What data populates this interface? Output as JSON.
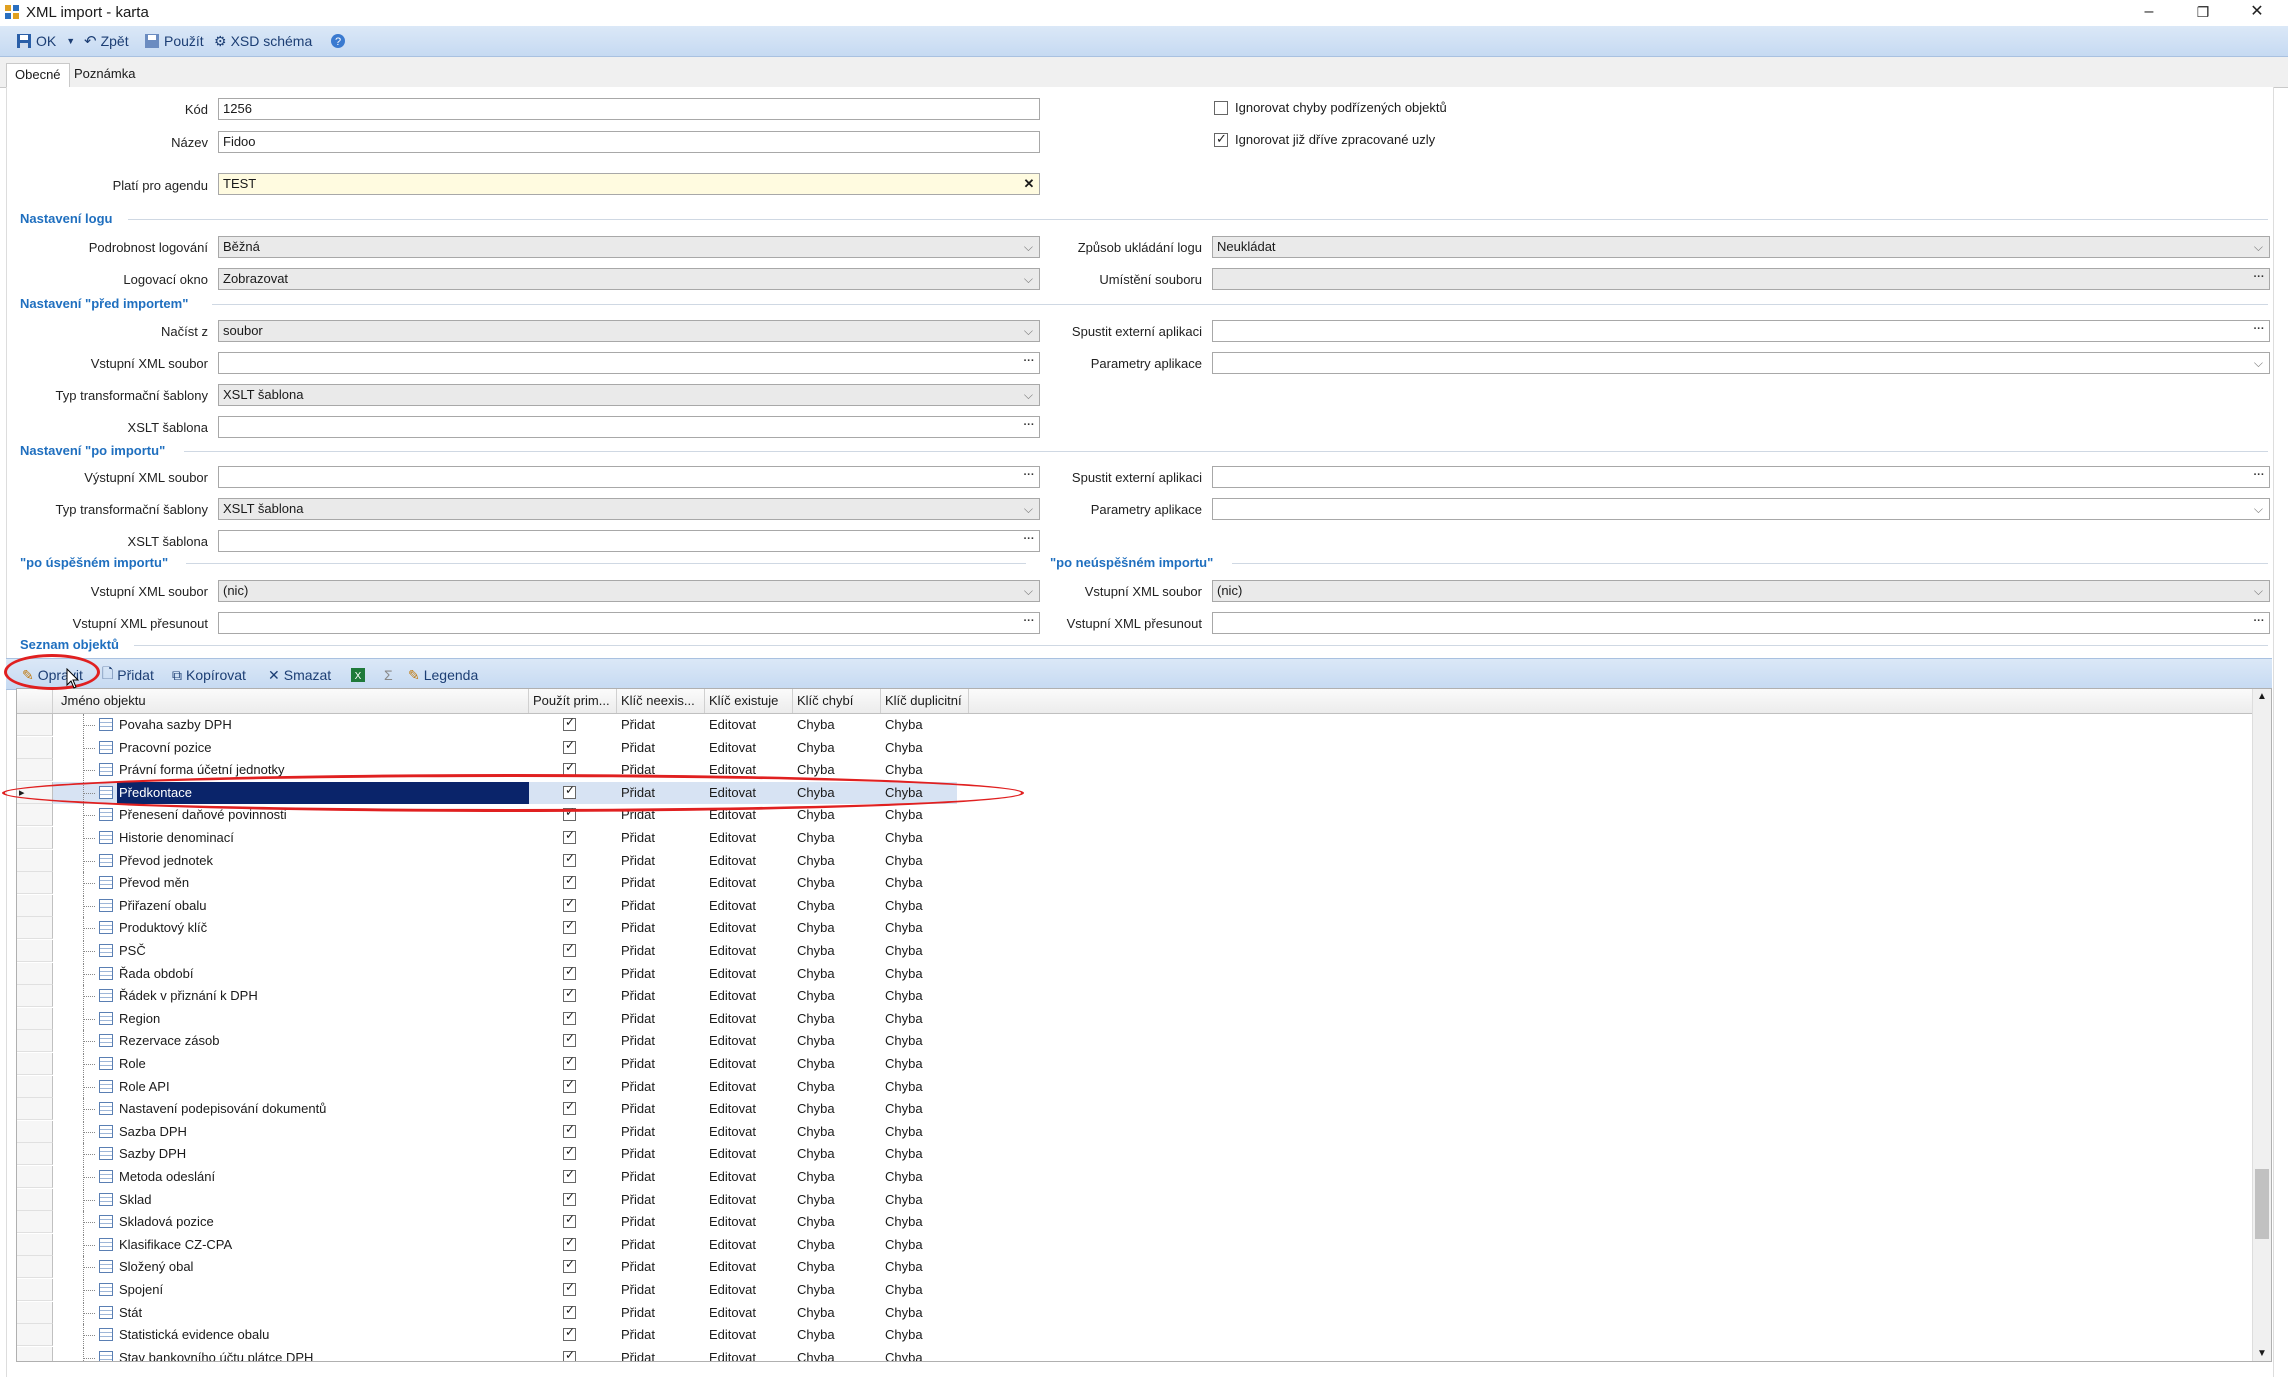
{
  "window": {
    "title": "XML import - karta",
    "min": "–",
    "max": "❐",
    "close": "✕"
  },
  "toolbar": {
    "ok": "OK",
    "back": "Zpět",
    "apply": "Použít",
    "xsd": "XSD schéma"
  },
  "tabs": [
    "Obecné",
    "Poznámka"
  ],
  "form": {
    "kod_label": "Kód",
    "kod_value": "1256",
    "nazev_label": "Název",
    "nazev_value": "Fidoo",
    "agenda_label": "Platí pro agendu",
    "agenda_value": "TEST",
    "ignore_child_errors": "Ignorovat chyby podřízených objektů",
    "ignore_processed": "Ignorovat již dříve zpracované uzly",
    "sec_log": "Nastavení logu",
    "log_detail_label": "Podrobnost logování",
    "log_detail_value": "Běžná",
    "log_window_label": "Logovací okno",
    "log_window_value": "Zobrazovat",
    "log_save_label": "Způsob ukládání logu",
    "log_save_value": "Neukládat",
    "file_loc_label": "Umístění souboru",
    "sec_pre": "Nastavení \"před importem\"",
    "load_from_label": "Načíst z",
    "load_from_value": "soubor",
    "input_xml_label": "Vstupní XML soubor",
    "transform_type_label": "Typ transformační šablony",
    "transform_type_value": "XSLT šablona",
    "xslt_label": "XSLT šablona",
    "run_ext_label": "Spustit externí aplikaci",
    "app_params_label": "Parametry aplikace",
    "sec_post": "Nastavení \"po importu\"",
    "output_xml_label": "Výstupní XML soubor",
    "sec_success": "\"po úspěšném importu\"",
    "sec_fail": "\"po neúspěšném importu\"",
    "input_xml_value": "(nic)",
    "move_xml_label": "Vstupní XML přesunout",
    "sec_objects": "Seznam objektů"
  },
  "gridtoolbar": {
    "edit": "Opravit",
    "add": "Přidat",
    "copy": "Kopírovat",
    "delete": "Smazat",
    "sigma": "Σ",
    "legend": "Legenda"
  },
  "grid": {
    "headers": [
      "Jméno objektu",
      "Použít prim...",
      "Klíč neexis...",
      "Klíč existuje",
      "Klíč chybí",
      "Klíč duplicitní"
    ],
    "rows": [
      {
        "name": "Povaha sazby DPH",
        "a": "Přidat",
        "b": "Editovat",
        "c": "Chyba",
        "d": "Chyba"
      },
      {
        "name": "Pracovní pozice",
        "a": "Přidat",
        "b": "Editovat",
        "c": "Chyba",
        "d": "Chyba"
      },
      {
        "name": "Právní forma účetní jednotky",
        "a": "Přidat",
        "b": "Editovat",
        "c": "Chyba",
        "d": "Chyba"
      },
      {
        "name": "Předkontace",
        "a": "Přidat",
        "b": "Editovat",
        "c": "Chyba",
        "d": "Chyba",
        "selected": true
      },
      {
        "name": "Přenesení daňové povinnosti",
        "a": "Přidat",
        "b": "Editovat",
        "c": "Chyba",
        "d": "Chyba"
      },
      {
        "name": "Historie denominací",
        "a": "Přidat",
        "b": "Editovat",
        "c": "Chyba",
        "d": "Chyba"
      },
      {
        "name": "Převod jednotek",
        "a": "Přidat",
        "b": "Editovat",
        "c": "Chyba",
        "d": "Chyba"
      },
      {
        "name": "Převod měn",
        "a": "Přidat",
        "b": "Editovat",
        "c": "Chyba",
        "d": "Chyba"
      },
      {
        "name": "Přiřazení obalu",
        "a": "Přidat",
        "b": "Editovat",
        "c": "Chyba",
        "d": "Chyba"
      },
      {
        "name": "Produktový klíč",
        "a": "Přidat",
        "b": "Editovat",
        "c": "Chyba",
        "d": "Chyba"
      },
      {
        "name": "PSČ",
        "a": "Přidat",
        "b": "Editovat",
        "c": "Chyba",
        "d": "Chyba"
      },
      {
        "name": "Řada období",
        "a": "Přidat",
        "b": "Editovat",
        "c": "Chyba",
        "d": "Chyba"
      },
      {
        "name": "Řádek v přiznání k DPH",
        "a": "Přidat",
        "b": "Editovat",
        "c": "Chyba",
        "d": "Chyba"
      },
      {
        "name": "Region",
        "a": "Přidat",
        "b": "Editovat",
        "c": "Chyba",
        "d": "Chyba"
      },
      {
        "name": "Rezervace zásob",
        "a": "Přidat",
        "b": "Editovat",
        "c": "Chyba",
        "d": "Chyba"
      },
      {
        "name": "Role",
        "a": "Přidat",
        "b": "Editovat",
        "c": "Chyba",
        "d": "Chyba"
      },
      {
        "name": "Role API",
        "a": "Přidat",
        "b": "Editovat",
        "c": "Chyba",
        "d": "Chyba"
      },
      {
        "name": "Nastavení podepisování dokumentů",
        "a": "Přidat",
        "b": "Editovat",
        "c": "Chyba",
        "d": "Chyba"
      },
      {
        "name": "Sazba DPH",
        "a": "Přidat",
        "b": "Editovat",
        "c": "Chyba",
        "d": "Chyba"
      },
      {
        "name": "Sazby DPH",
        "a": "Přidat",
        "b": "Editovat",
        "c": "Chyba",
        "d": "Chyba"
      },
      {
        "name": "Metoda odeslání",
        "a": "Přidat",
        "b": "Editovat",
        "c": "Chyba",
        "d": "Chyba"
      },
      {
        "name": "Sklad",
        "a": "Přidat",
        "b": "Editovat",
        "c": "Chyba",
        "d": "Chyba"
      },
      {
        "name": "Skladová pozice",
        "a": "Přidat",
        "b": "Editovat",
        "c": "Chyba",
        "d": "Chyba"
      },
      {
        "name": "Klasifikace CZ-CPA",
        "a": "Přidat",
        "b": "Editovat",
        "c": "Chyba",
        "d": "Chyba"
      },
      {
        "name": "Složený obal",
        "a": "Přidat",
        "b": "Editovat",
        "c": "Chyba",
        "d": "Chyba"
      },
      {
        "name": "Spojení",
        "a": "Přidat",
        "b": "Editovat",
        "c": "Chyba",
        "d": "Chyba"
      },
      {
        "name": "Stát",
        "a": "Přidat",
        "b": "Editovat",
        "c": "Chyba",
        "d": "Chyba"
      },
      {
        "name": "Statistická evidence obalu",
        "a": "Přidat",
        "b": "Editovat",
        "c": "Chyba",
        "d": "Chyba"
      },
      {
        "name": "Stav bankovního účtu plátce DPH",
        "a": "Přidat",
        "b": "Editovat",
        "c": "Chyba",
        "d": "Chyba"
      }
    ]
  },
  "colors": {
    "accent": "#1f6fbf",
    "highlight": "#e02020",
    "selection": "#0a246a"
  },
  "icons": [
    "save-icon",
    "undo-icon",
    "apply-icon",
    "xsd-icon",
    "help-icon",
    "edit-icon",
    "add-icon",
    "copy-icon",
    "delete-icon",
    "excel-icon",
    "legend-icon",
    "table-icon",
    "checkbox-icon"
  ]
}
